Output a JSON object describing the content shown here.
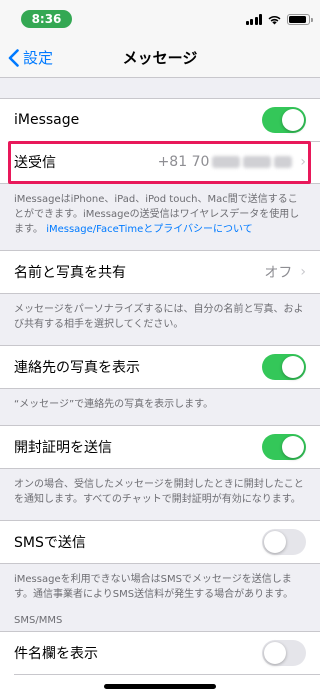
{
  "status_bar": {
    "time": "8:36",
    "battery_level": 0.9
  },
  "nav": {
    "back_label": "設定",
    "title": "メッセージ"
  },
  "imessage": {
    "label": "iMessage",
    "toggle_on": true,
    "send_receive_label": "送受信",
    "phone_prefix": "+81 70",
    "footer": "iMessageはiPhone、iPad、iPod touch、Mac間で送信することができます。iMessageの送受信はワイヤレスデータを使用します。",
    "footer_link": "iMessage/FaceTimeとプライバシーについて"
  },
  "share_name": {
    "label": "名前と写真を共有",
    "value": "オフ",
    "footer": "メッセージをパーソナライズするには、自分の名前と写真、および共有する相手を選択してください。"
  },
  "contact_photos": {
    "label": "連絡先の写真を表示",
    "toggle_on": true,
    "footer": "“メッセージ”で連絡先の写真を表示します。"
  },
  "read_receipts": {
    "label": "開封証明を送信",
    "toggle_on": true,
    "footer": "オンの場合、受信したメッセージを開封したときに開封したことを通知します。すべてのチャットで開封証明が有効になります。"
  },
  "sms": {
    "label": "SMSで送信",
    "toggle_on": false,
    "footer": "iMessageを利用できない場合はSMSでメッセージを送信します。通信事業者によりSMS送信料が発生する場合があります。"
  },
  "sms_mms": {
    "header": "SMS/MMS",
    "subject_label": "件名欄を表示",
    "subject_toggle_on": false
  }
}
